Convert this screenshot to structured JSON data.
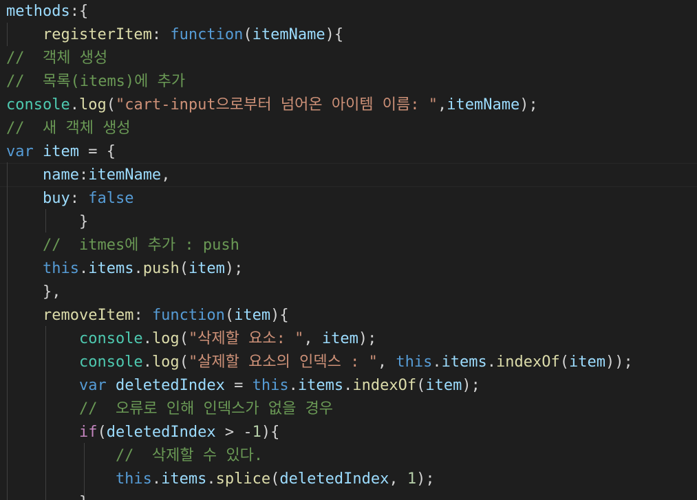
{
  "colors": {
    "background": "#1e1e1e",
    "variable": "#9cdcfe",
    "function": "#dcdcaa",
    "keyword": "#569cd6",
    "control": "#c586c0",
    "string": "#ce9178",
    "comment": "#6a9955",
    "number": "#b5cea8",
    "punctuation": "#d4d4d4"
  },
  "code_lines": [
    [
      {
        "t": "methods",
        "c": "var"
      },
      {
        "t": ":{",
        "c": "pun"
      }
    ],
    [
      {
        "t": "    registerItem",
        "c": "fn"
      },
      {
        "t": ": ",
        "c": "pun"
      },
      {
        "t": "function",
        "c": "kw"
      },
      {
        "t": "(",
        "c": "pun"
      },
      {
        "t": "itemName",
        "c": "var"
      },
      {
        "t": "){",
        "c": "pun"
      }
    ],
    [
      {
        "t": "//  객체 생성",
        "c": "com"
      }
    ],
    [
      {
        "t": "//  목록(items)에 추가",
        "c": "com"
      }
    ],
    [
      {
        "t": "console",
        "c": "cls"
      },
      {
        "t": ".",
        "c": "pun"
      },
      {
        "t": "log",
        "c": "fn"
      },
      {
        "t": "(",
        "c": "pun"
      },
      {
        "t": "\"cart-input으로부터 넘어온 아이템 이름: \"",
        "c": "str"
      },
      {
        "t": ",",
        "c": "pun"
      },
      {
        "t": "itemName",
        "c": "var"
      },
      {
        "t": ");",
        "c": "pun"
      }
    ],
    [
      {
        "t": "//  새 객체 생성",
        "c": "com"
      }
    ],
    [
      {
        "t": "var",
        "c": "kw"
      },
      {
        "t": " ",
        "c": "pun"
      },
      {
        "t": "item",
        "c": "var"
      },
      {
        "t": " = {",
        "c": "pun"
      }
    ],
    [
      {
        "t": "    name",
        "c": "var"
      },
      {
        "t": ":",
        "c": "pun"
      },
      {
        "t": "itemName",
        "c": "var"
      },
      {
        "t": ",",
        "c": "pun"
      }
    ],
    [
      {
        "t": "    buy",
        "c": "var"
      },
      {
        "t": ": ",
        "c": "pun"
      },
      {
        "t": "false",
        "c": "kw"
      }
    ],
    [
      {
        "t": "        }",
        "c": "pun"
      }
    ],
    [
      {
        "t": "    //  itmes에 추가 : push",
        "c": "com"
      }
    ],
    [
      {
        "t": "    this",
        "c": "kw"
      },
      {
        "t": ".",
        "c": "pun"
      },
      {
        "t": "items",
        "c": "var"
      },
      {
        "t": ".",
        "c": "pun"
      },
      {
        "t": "push",
        "c": "fn"
      },
      {
        "t": "(",
        "c": "pun"
      },
      {
        "t": "item",
        "c": "var"
      },
      {
        "t": ");",
        "c": "pun"
      }
    ],
    [
      {
        "t": "    },",
        "c": "pun"
      }
    ],
    [
      {
        "t": "    removeItem",
        "c": "fn"
      },
      {
        "t": ": ",
        "c": "pun"
      },
      {
        "t": "function",
        "c": "kw"
      },
      {
        "t": "(",
        "c": "pun"
      },
      {
        "t": "item",
        "c": "var"
      },
      {
        "t": "){",
        "c": "pun"
      }
    ],
    [
      {
        "t": "        console",
        "c": "cls"
      },
      {
        "t": ".",
        "c": "pun"
      },
      {
        "t": "log",
        "c": "fn"
      },
      {
        "t": "(",
        "c": "pun"
      },
      {
        "t": "\"삭제할 요소: \"",
        "c": "str"
      },
      {
        "t": ", ",
        "c": "pun"
      },
      {
        "t": "item",
        "c": "var"
      },
      {
        "t": ");",
        "c": "pun"
      }
    ],
    [
      {
        "t": "        console",
        "c": "cls"
      },
      {
        "t": ".",
        "c": "pun"
      },
      {
        "t": "log",
        "c": "fn"
      },
      {
        "t": "(",
        "c": "pun"
      },
      {
        "t": "\"살제할 요소의 인덱스 : \"",
        "c": "str"
      },
      {
        "t": ", ",
        "c": "pun"
      },
      {
        "t": "this",
        "c": "kw"
      },
      {
        "t": ".",
        "c": "pun"
      },
      {
        "t": "items",
        "c": "var"
      },
      {
        "t": ".",
        "c": "pun"
      },
      {
        "t": "indexOf",
        "c": "fn"
      },
      {
        "t": "(",
        "c": "pun"
      },
      {
        "t": "item",
        "c": "var"
      },
      {
        "t": "));",
        "c": "pun"
      }
    ],
    [
      {
        "t": "        var",
        "c": "kw"
      },
      {
        "t": " ",
        "c": "pun"
      },
      {
        "t": "deletedIndex",
        "c": "var"
      },
      {
        "t": " = ",
        "c": "pun"
      },
      {
        "t": "this",
        "c": "kw"
      },
      {
        "t": ".",
        "c": "pun"
      },
      {
        "t": "items",
        "c": "var"
      },
      {
        "t": ".",
        "c": "pun"
      },
      {
        "t": "indexOf",
        "c": "fn"
      },
      {
        "t": "(",
        "c": "pun"
      },
      {
        "t": "item",
        "c": "var"
      },
      {
        "t": ");",
        "c": "pun"
      }
    ],
    [
      {
        "t": "        //  오류로 인해 인덱스가 없을 경우",
        "c": "com"
      }
    ],
    [
      {
        "t": "        if",
        "c": "ctrl"
      },
      {
        "t": "(",
        "c": "pun"
      },
      {
        "t": "deletedIndex",
        "c": "var"
      },
      {
        "t": " > -",
        "c": "pun"
      },
      {
        "t": "1",
        "c": "num"
      },
      {
        "t": "){",
        "c": "pun"
      }
    ],
    [
      {
        "t": "            //  삭제할 수 있다.",
        "c": "com"
      }
    ],
    [
      {
        "t": "            this",
        "c": "kw"
      },
      {
        "t": ".",
        "c": "pun"
      },
      {
        "t": "items",
        "c": "var"
      },
      {
        "t": ".",
        "c": "pun"
      },
      {
        "t": "splice",
        "c": "fn"
      },
      {
        "t": "(",
        "c": "pun"
      },
      {
        "t": "deletedIndex",
        "c": "var"
      },
      {
        "t": ", ",
        "c": "pun"
      },
      {
        "t": "1",
        "c": "num"
      },
      {
        "t": ");",
        "c": "pun"
      }
    ],
    [
      {
        "t": "        }",
        "c": "pun"
      }
    ]
  ]
}
